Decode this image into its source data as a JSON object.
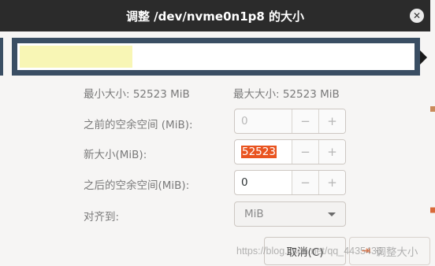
{
  "dialog": {
    "title": "调整 /dev/nvme0n1p8 的大小",
    "close_icon": "close-icon"
  },
  "partition_bar": {
    "used_fraction": 0.29,
    "border_color": "#3a4e63",
    "used_color": "#f8f6b5"
  },
  "info": {
    "min_size": "最小大小:  52523 MiB",
    "max_size": "最大大小:  52523 MiB"
  },
  "fields": {
    "free_before": {
      "label": "之前的空余空间 (MiB):",
      "value": "0"
    },
    "new_size": {
      "label": "新大小(MiB):",
      "value": "52523"
    },
    "free_after": {
      "label": "之后的空余空间(MiB):",
      "value": "0"
    },
    "align": {
      "label": "对齐到:",
      "value": "MiB"
    }
  },
  "spin_buttons": {
    "minus": "−",
    "plus": "+"
  },
  "buttons": {
    "cancel": "取消(C)",
    "resize": "调整大小"
  },
  "watermark": "https://blog.csdn.net/qq_4435436",
  "accent_color": "#e95420"
}
